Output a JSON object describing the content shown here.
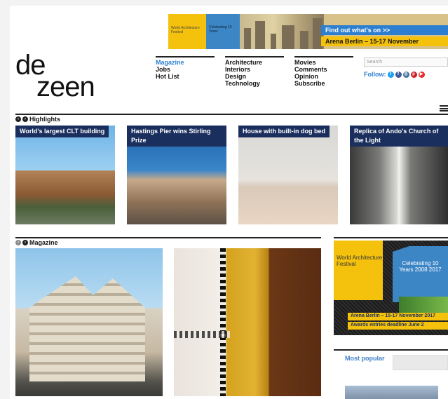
{
  "banner": {
    "yellow_text": "World Architecture Festival",
    "blue_text": "Celebrating 10 Years",
    "find_out": "Find out what's on >>",
    "arena": "Arena Berlin – 15-17 November"
  },
  "logo": {
    "line1": "de",
    "line2": "zeen"
  },
  "nav": {
    "col1": [
      "Magazine",
      "Jobs",
      "Hot List"
    ],
    "col2": [
      "Architecture",
      "Interiors",
      "Design",
      "Technology"
    ],
    "col3": [
      "Movies",
      "Comments",
      "Opinion",
      "Subscribe"
    ]
  },
  "search": {
    "placeholder": "Search"
  },
  "follow": {
    "label": "Follow:",
    "icons": [
      "twitter-icon",
      "facebook-icon",
      "instagram-icon",
      "pinterest-icon",
      "youtube-icon"
    ]
  },
  "highlights": {
    "heading": "Highlights",
    "cards": [
      {
        "caption": "World's largest CLT building"
      },
      {
        "caption": "Hastings Pier wins Stirling Prize"
      },
      {
        "caption": "House with built-in dog bed"
      },
      {
        "caption": "Replica of Ando's Church of the Light"
      }
    ]
  },
  "magazine": {
    "heading": "Magazine"
  },
  "waf_ad": {
    "yellow_text": "World Architecture Festival",
    "blue_text": "Celebrating 10 Years 2008 2017",
    "line1": "Arena Berlin – 15-17 November 2017",
    "line2": "Awards entries deadline June 2"
  },
  "most_popular": {
    "label": "Most popular"
  },
  "colors": {
    "accent_blue": "#2c7fd0",
    "yellow": "#f4c20d",
    "navy": "#1b2f5e"
  }
}
